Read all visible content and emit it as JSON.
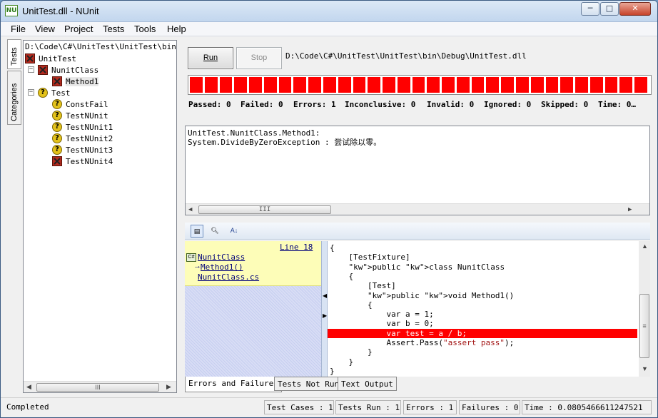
{
  "window": {
    "title": "UnitTest.dll - NUnit",
    "icon_label": "NU"
  },
  "window_controls": {
    "minimize": "─",
    "maximize": "□",
    "close": "✕"
  },
  "menu": [
    "File",
    "View",
    "Project",
    "Tests",
    "Tools",
    "Help"
  ],
  "side_tabs": [
    "Tests",
    "Categories"
  ],
  "tree": {
    "path": "D:\\Code\\C#\\UnitTest\\UnitTest\\bin\\Debug\\UnitTest.dll",
    "nodes": [
      {
        "label": "UnitTest",
        "status": "failed",
        "level": 0,
        "expander": ""
      },
      {
        "label": "NunitClass",
        "status": "failed",
        "level": 1,
        "expander": "−"
      },
      {
        "label": "Method1",
        "status": "failed",
        "level": 2,
        "expander": ""
      },
      {
        "label": "Test",
        "status": "unknown",
        "level": 1,
        "expander": "−"
      },
      {
        "label": "ConstFail",
        "status": "unknown",
        "level": 2,
        "expander": ""
      },
      {
        "label": "TestNUnit",
        "status": "unknown",
        "level": 2,
        "expander": ""
      },
      {
        "label": "TestNUnit1",
        "status": "unknown",
        "level": 2,
        "expander": ""
      },
      {
        "label": "TestNUnit2",
        "status": "unknown",
        "level": 2,
        "expander": ""
      },
      {
        "label": "TestNUnit3",
        "status": "unknown",
        "level": 2,
        "expander": ""
      },
      {
        "label": "TestNUnit4",
        "status": "failed",
        "level": 2,
        "expander": ""
      }
    ],
    "scroll_grip": "III"
  },
  "run_panel": {
    "run_label": "Run",
    "stop_label": "Stop",
    "assembly_path": "D:\\Code\\C#\\UnitTest\\UnitTest\\bin\\Debug\\UnitTest.dll",
    "progress": {
      "fraction": 1.0,
      "color": "#ff0000",
      "segments": 31
    },
    "stats": {
      "passed": "Passed: 0",
      "failed": "Failed: 0",
      "errors": "Errors: 1",
      "inconclusive": "Inconclusive: 0",
      "invalid": "Invalid: 0",
      "ignored": "Ignored: 0",
      "skipped": "Skipped: 0",
      "time": "Time: 0…"
    }
  },
  "error_output": {
    "lines": [
      "UnitTest.NunitClass.Method1:",
      "System.DivideByZeroException : 尝试除以零。"
    ],
    "scroll_grip": "III"
  },
  "stack_trace": {
    "line_label": "Line 18",
    "class_name": "NunitClass",
    "method_name": "Method1()",
    "file_name": "NunitClass.cs",
    "class_icon": "C#"
  },
  "code_view": {
    "lines": [
      {
        "text": "{",
        "highlight": false
      },
      {
        "text": "    [TestFixture]",
        "highlight": false
      },
      {
        "text": "    public class NunitClass",
        "highlight": false
      },
      {
        "text": "    {",
        "highlight": false
      },
      {
        "text": "        [Test]",
        "highlight": false
      },
      {
        "text": "        public void Method1()",
        "highlight": false
      },
      {
        "text": "        {",
        "highlight": false
      },
      {
        "text": "            var a = 1;",
        "highlight": false
      },
      {
        "text": "            var b = 0;",
        "highlight": false
      },
      {
        "text": "            var test = a / b;",
        "highlight": true
      },
      {
        "text": "            Assert.Pass(\"assert pass\");",
        "highlight": false
      },
      {
        "text": "        }",
        "highlight": false
      },
      {
        "text": "    }",
        "highlight": false
      },
      {
        "text": "}",
        "highlight": false
      }
    ],
    "highlight_color": "#ff0000",
    "scroll_grip": "≡"
  },
  "bottom_tabs": [
    "Errors and Failures",
    "Tests Not Run",
    "Text Output"
  ],
  "status_bar": {
    "state": "Completed",
    "test_cases": "Test Cases : 1",
    "tests_run": "Tests Run : 1",
    "errors": "Errors : 1",
    "failures": "Failures : 0",
    "time": "Time : 0.0805466611247521"
  }
}
